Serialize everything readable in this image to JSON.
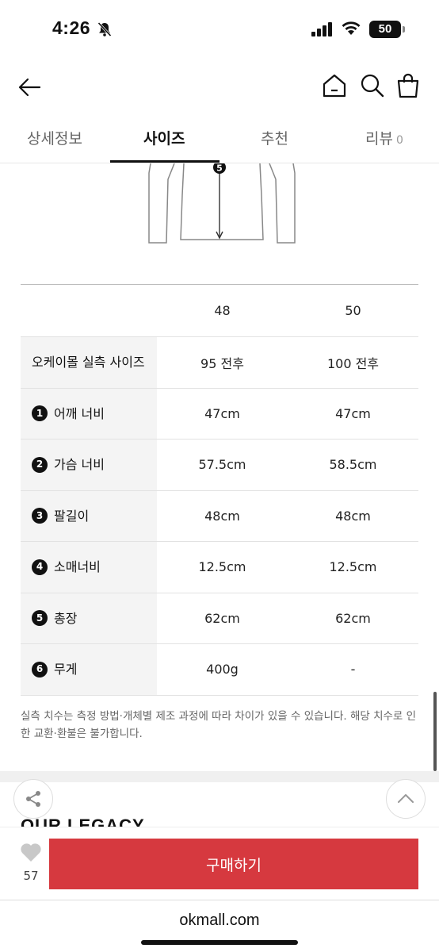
{
  "status": {
    "time": "4:26",
    "battery": "50"
  },
  "tabs": [
    {
      "label": "상세정보"
    },
    {
      "label": "사이즈"
    },
    {
      "label": "추천"
    },
    {
      "label": "리뷰",
      "count": "0"
    }
  ],
  "diagram": {
    "marker": "5"
  },
  "size_table": {
    "sizes": [
      "48",
      "50"
    ],
    "rows": [
      {
        "badge": "",
        "label": "오케이몰 실측 사이즈",
        "values": [
          "95 전후",
          "100 전후"
        ]
      },
      {
        "badge": "1",
        "label": "어깨 너비",
        "values": [
          "47cm",
          "47cm"
        ]
      },
      {
        "badge": "2",
        "label": "가슴 너비",
        "values": [
          "57.5cm",
          "58.5cm"
        ]
      },
      {
        "badge": "3",
        "label": "팔길이",
        "values": [
          "48cm",
          "48cm"
        ]
      },
      {
        "badge": "4",
        "label": "소매너비",
        "values": [
          "12.5cm",
          "12.5cm"
        ]
      },
      {
        "badge": "5",
        "label": "총장",
        "values": [
          "62cm",
          "62cm"
        ]
      },
      {
        "badge": "6",
        "label": "무게",
        "values": [
          "400g",
          "-"
        ]
      }
    ]
  },
  "note": "실측 치수는 측정 방법·개체별 제조 과정에 따라 차이가 있을 수 있습니다. 해당 치수로 인한 교환·환불은 불가합니다.",
  "brand_peek": "OUR LEGACY",
  "bottom": {
    "like_count": "57",
    "buy_label": "구매하기"
  },
  "url": "okmall.com",
  "colors": {
    "buy_button": "#d6393f",
    "text": "#111111"
  }
}
